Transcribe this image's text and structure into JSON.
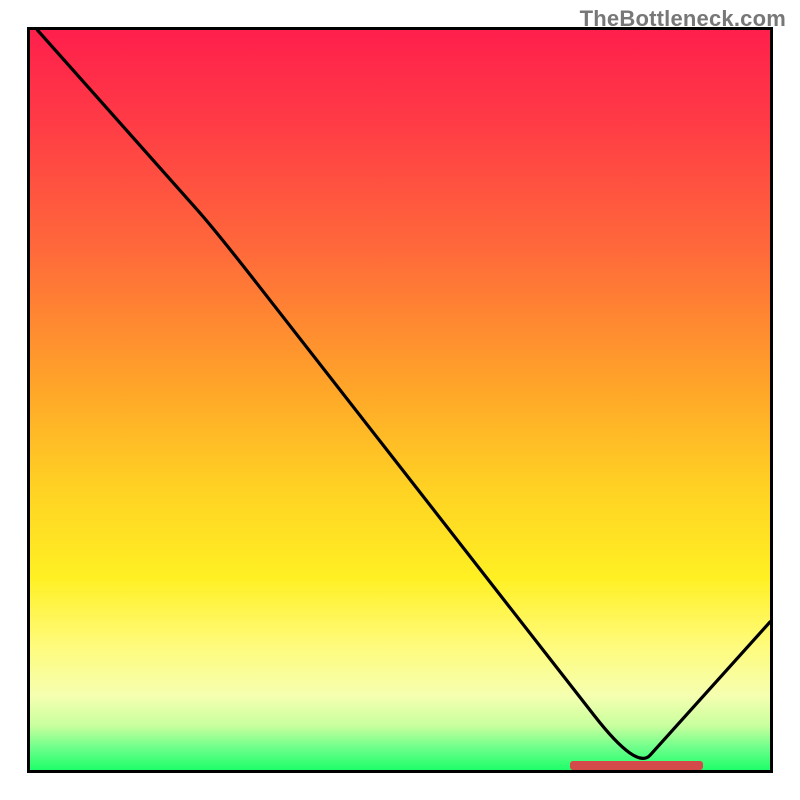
{
  "watermark": "TheBottleneck.com",
  "colors": {
    "frame": "#000000",
    "curve": "#000000",
    "marker": "#d44a4a"
  },
  "chart_data": {
    "type": "line",
    "title": "",
    "xlabel": "",
    "ylabel": "",
    "xlim": [
      0,
      100
    ],
    "ylim": [
      0,
      100
    ],
    "x": [
      1,
      25,
      82,
      100
    ],
    "values": [
      100,
      73,
      0,
      20
    ],
    "marker": {
      "x_start": 73,
      "x_end": 91,
      "y": 0
    },
    "gradient_stops": [
      {
        "pos": 0,
        "color": "#ff1f4c"
      },
      {
        "pos": 12,
        "color": "#ff3a46"
      },
      {
        "pos": 30,
        "color": "#ff6a3a"
      },
      {
        "pos": 48,
        "color": "#ffa429"
      },
      {
        "pos": 62,
        "color": "#ffd223"
      },
      {
        "pos": 74,
        "color": "#fff023"
      },
      {
        "pos": 83,
        "color": "#fffb7a"
      },
      {
        "pos": 90,
        "color": "#f5ffb0"
      },
      {
        "pos": 94,
        "color": "#c9ff9e"
      },
      {
        "pos": 97,
        "color": "#6dff8a"
      },
      {
        "pos": 100,
        "color": "#1eff6a"
      }
    ]
  }
}
